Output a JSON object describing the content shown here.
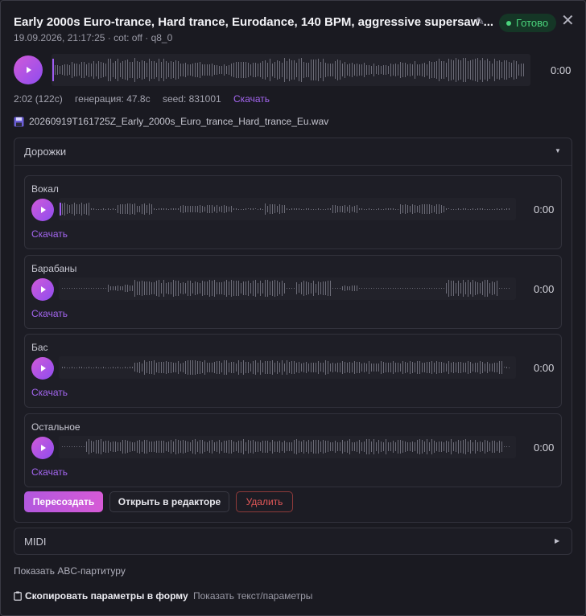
{
  "header": {
    "title": "Early 2000s Euro-trance, Hard trance, Eurodance, 140 BPM, aggressive supersaw ...",
    "status": "Готово",
    "subtitle": "19.09.2026, 21:17:25 · cot: off · q8_0",
    "icons": {
      "edit": "pencil-icon",
      "close": "close-icon"
    }
  },
  "main_player": {
    "time": "0:00",
    "progress": 0,
    "duration": "2:02 (122с)",
    "generation": "генерация: 47.8с",
    "seed": "seed: 831001",
    "download": "Скачать",
    "filename": "20260919T161725Z_Early_2000s_Euro_trance_Hard_trance_Eu.wav",
    "file_icon": "floppy-disk-icon"
  },
  "tracks_panel": {
    "label": "Дорожки",
    "expanded": true,
    "tracks": [
      {
        "name": "Вокал",
        "time": "0:00",
        "download": "Скачать"
      },
      {
        "name": "Барабаны",
        "time": "0:00",
        "download": "Скачать"
      },
      {
        "name": "Бас",
        "time": "0:00",
        "download": "Скачать"
      },
      {
        "name": "Остальное",
        "time": "0:00",
        "download": "Скачать"
      }
    ],
    "actions": {
      "recreate": "Пересоздать",
      "open_editor": "Открыть в редакторе",
      "delete": "Удалить"
    }
  },
  "midi_panel": {
    "label": "MIDI",
    "expanded": false
  },
  "footer": {
    "show_abc": "Показать ABC-партитуру",
    "copy_params": "Скопировать параметры в форму",
    "copy_icon": "clipboard-icon",
    "show_text": "Показать текст/параметры"
  },
  "colors": {
    "accent": "#a466f0",
    "play_gradient_start": "#d15ad8",
    "play_gradient_end": "#8e4df0",
    "status_green": "#4ad47c",
    "danger": "#e05757",
    "background": "#1a1a21"
  }
}
